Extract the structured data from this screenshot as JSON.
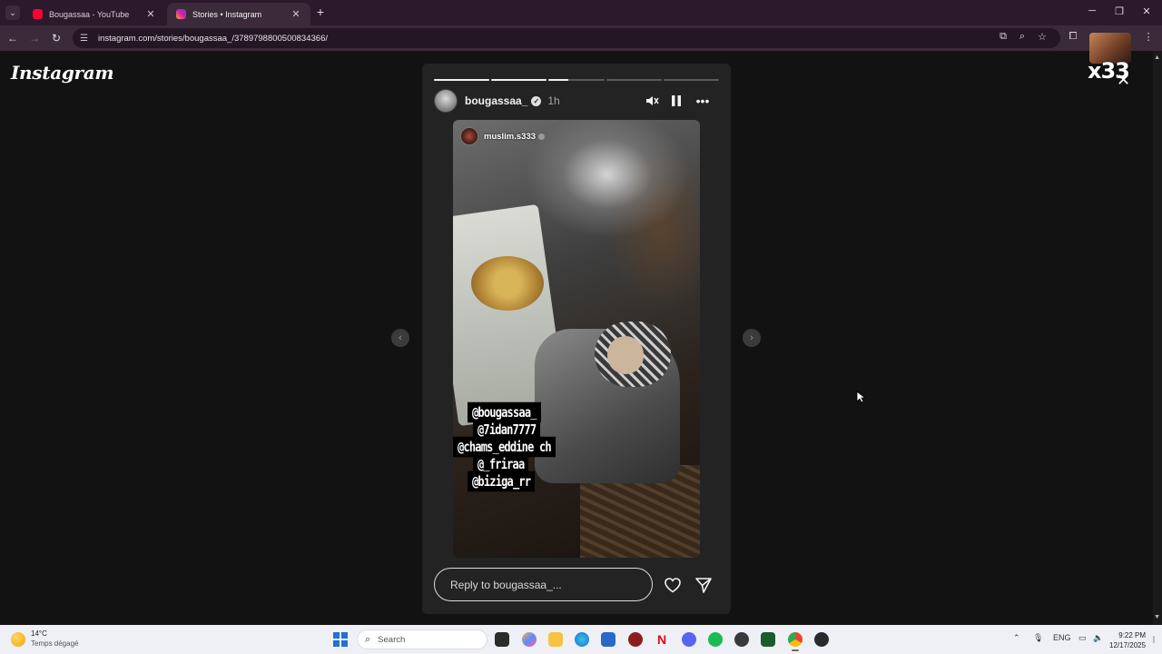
{
  "browser": {
    "tabs": [
      {
        "title": "Bougassaa - YouTube",
        "favicon_color": "#ff0033"
      },
      {
        "title": "Stories • Instagram",
        "favicon_color": "#d6249f"
      }
    ],
    "url": "instagram.com/stories/bougassaa_/3789798800500834366/",
    "overlay_badge": "x33",
    "overlay_close": "✕"
  },
  "page": {
    "logo": "Instagram"
  },
  "story": {
    "progress": [
      1,
      1,
      0.35,
      0,
      0
    ],
    "author": {
      "name": "bougassaa_",
      "time": "1h"
    },
    "repost_author": "muslim.s333",
    "tags": [
      "@bougassaa_",
      "@7idan7777",
      "@chams_eddine ch",
      "@_friraa",
      "@biziga_rr"
    ],
    "reply_placeholder": "Reply to bougassaa_..."
  },
  "taskbar": {
    "weather_temp": "14°C",
    "weather_condition": "Temps dégagé",
    "search_label": "Search",
    "language": "ENG",
    "time": "9:22 PM",
    "date": "12/17/2025"
  }
}
